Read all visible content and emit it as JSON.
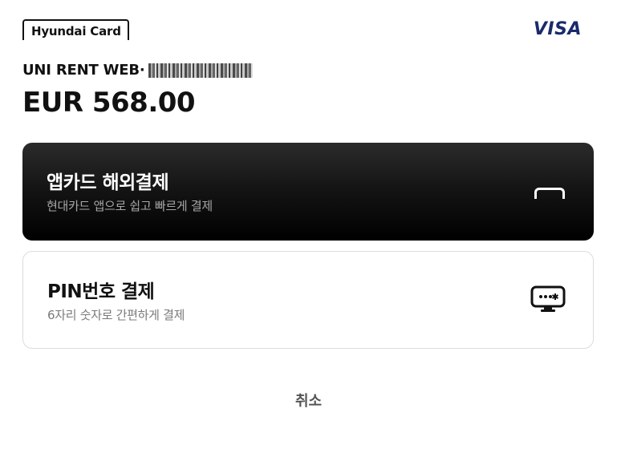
{
  "brand": {
    "issuer_logo_text": "Hyundai Card",
    "network_logo_text": "VISA",
    "network_color": "#1a2a6c"
  },
  "payment": {
    "merchant_name": "UNI RENT WEB·",
    "amount": "EUR 568.00"
  },
  "options": [
    {
      "title": "앱카드 해외결제",
      "subtitle": "현대카드 앱으로 쉽고 빠르게 결제",
      "icon": "phone-card-icon",
      "style": "dark"
    },
    {
      "title": "PIN번호 결제",
      "subtitle": "6자리 숫자로 간편하게 결제",
      "icon": "pin-monitor-icon",
      "style": "light"
    }
  ],
  "actions": {
    "cancel_label": "취소"
  }
}
